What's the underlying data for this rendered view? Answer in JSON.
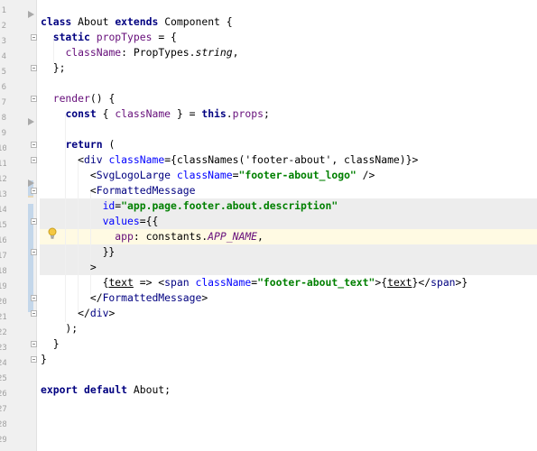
{
  "editor": {
    "gutter": {
      "line_numbers": [
        "1",
        "2",
        "3",
        "4",
        "5",
        "6",
        "7",
        "8",
        "9",
        "10",
        "11",
        "12",
        "13",
        "14",
        "15",
        "16",
        "17",
        "18",
        "19",
        "20",
        "21",
        "22",
        "23",
        "24",
        "25",
        "26",
        "27",
        "28",
        "29"
      ]
    },
    "code_lines": [
      "class About extends Component {",
      "  static propTypes = {",
      "    className: PropTypes.string,",
      "  };",
      "",
      "  render() {",
      "    const { className } = this.props;",
      "",
      "    return (",
      "      <div className={classNames('footer-about', className)}>",
      "        <SvgLogoLarge className=\"footer-about_logo\" />",
      "        <FormattedMessage",
      "          id=\"app.page.footer.about.description\"",
      "          values={{",
      "            app: constants.APP_NAME,",
      "          }}",
      "        >",
      "          {text => <span className=\"footer-about_text\">{text}</span>}",
      "        </FormattedMessage>",
      "      </div>",
      "    );",
      "  }",
      "}",
      "",
      "export default About;"
    ],
    "current_line_index": 14,
    "colors": {
      "keyword": "#000080",
      "string": "#008000",
      "attribute": "#0000ff",
      "property": "#660e7a",
      "gutter": "#f0f0f0",
      "current_line": "#fffae3",
      "highlight": "#ededed"
    },
    "icons": {
      "bulb": "lightbulb-icon",
      "fold": "fold-marker-icon",
      "arrow": "breakpoint-arrow-icon"
    }
  }
}
